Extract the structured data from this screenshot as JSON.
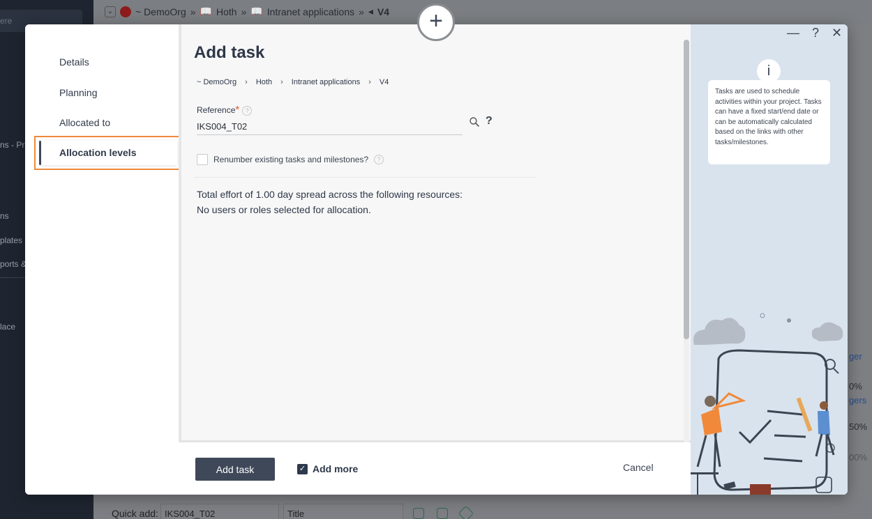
{
  "background": {
    "sidebar": {
      "search_text": "ere",
      "labels": [
        "ns - Pro",
        "ns",
        "plates",
        "ports &",
        "lace"
      ]
    },
    "breadcrumb": [
      "~ DemoOrg",
      "Hoth",
      "Intranet applications",
      "V4"
    ],
    "right_snippets": [
      "ger",
      "0%",
      "gers",
      "50%",
      "00%"
    ],
    "quick_add": {
      "label": "Quick add:",
      "reference": "IKS004_T02",
      "title_placeholder": "Title"
    }
  },
  "modal": {
    "nav": {
      "items": [
        "Details",
        "Planning",
        "Allocated to",
        "Allocation levels"
      ],
      "active": "Allocation levels"
    },
    "title": "Add task",
    "breadcrumb": [
      "~ DemoOrg",
      "Hoth",
      "Intranet applications",
      "V4"
    ],
    "reference": {
      "label": "Reference",
      "required_mark": "*",
      "value": "IKS004_T02",
      "help": "?"
    },
    "renumber_label": "Renumber existing tasks and milestones?",
    "effort_line1": "Total effort of 1.00 day spread across the following resources:",
    "effort_line2": "No users or roles selected for allocation.",
    "footer": {
      "add_button": "Add task",
      "add_more": "Add more",
      "cancel": "Cancel"
    },
    "window_controls": {
      "minimize": "—",
      "help": "?",
      "close": "✕"
    },
    "info": {
      "icon": "i",
      "text": "Tasks are used to schedule activities within your project. Tasks can have a fixed start/end date or can be automatically calculated based on the links with other tasks/milestones."
    },
    "plus": "+"
  },
  "colors": {
    "accent": "#f0893a",
    "primary": "#3e4859",
    "side_panel": "#d9e3ee"
  }
}
